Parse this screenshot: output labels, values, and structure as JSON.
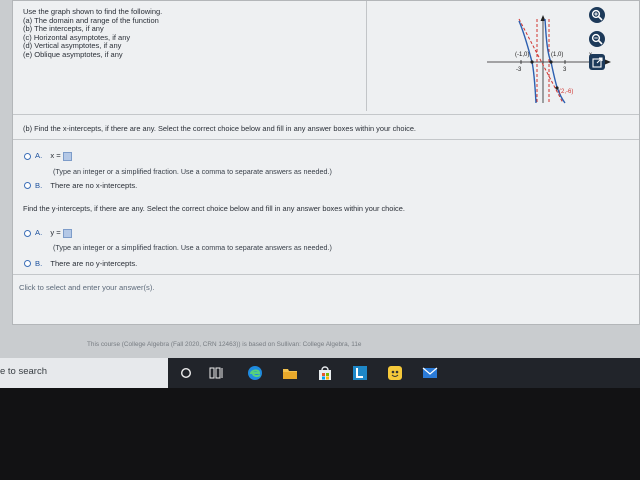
{
  "question": {
    "intro": "Use the graph shown to find the following.",
    "items": [
      "(a) The domain and range of the function",
      "(b) The intercepts, if any",
      "(c) Horizontal asymptotes, if any",
      "(d) Vertical asymptotes, if any",
      "(e) Oblique asymptotes, if any"
    ]
  },
  "graph": {
    "point_left": "(-1,0)",
    "point_right": "(1,0)",
    "axis_x": "x",
    "tick_neg": "-3",
    "tick_pos": "3",
    "point_low": "(2,-6)"
  },
  "part_b": {
    "instruction": "(b) Find the x-intercepts, if there are any. Select the correct choice below and fill in any answer boxes within your choice.",
    "choice_a_label": "A.",
    "choice_a_expr": "x =",
    "choice_a_hint": "(Type an integer or a simplified fraction. Use a comma to separate answers as needed.)",
    "choice_b_label": "B.",
    "choice_b_text": "There are no x-intercepts."
  },
  "part_y": {
    "instruction": "Find the y-intercepts, if there are any. Select the correct choice below and fill in any answer boxes within your choice.",
    "choice_a_label": "A.",
    "choice_a_expr": "y =",
    "choice_a_hint": "(Type an integer or a simplified fraction. Use a comma to separate answers as needed.)",
    "choice_b_label": "B.",
    "choice_b_text": "There are no y-intercepts."
  },
  "click_prompt": "Click to select and enter your answer(s).",
  "footer": "This course (College Algebra (Fall 2020, CRN 12463)) is based on Sullivan: College Algebra, 11e",
  "taskbar": {
    "search_text": "e to search"
  },
  "colors": {
    "accent": "#1a4f9c",
    "tool_bg": "#1d3a5a",
    "asymptote": "#d0332f",
    "curve": "#2c5fb0"
  }
}
